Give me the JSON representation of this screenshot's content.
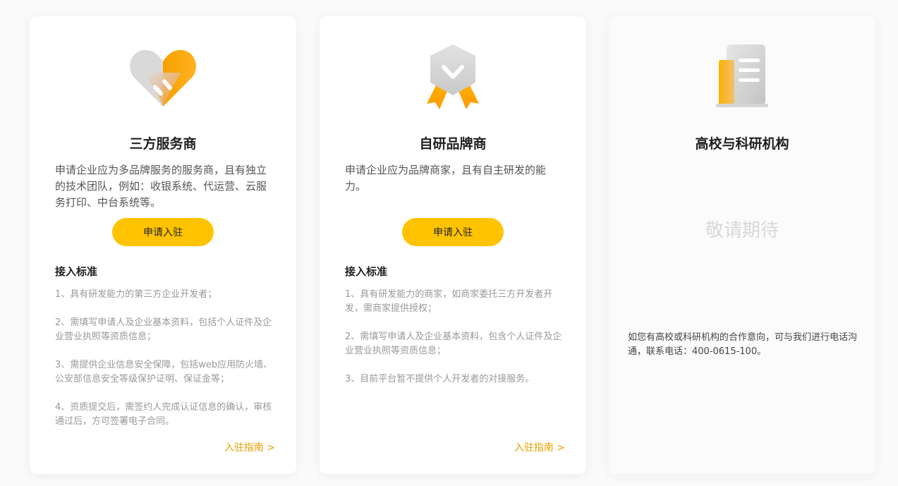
{
  "cards": [
    {
      "title": "三方服务商",
      "description": "申请企业应为多品牌服务的服务商，且有独立的技术团队，例如：收银系统、代运营、云服务打印、中台系统等。",
      "apply_label": "申请入驻",
      "standards_title": "接入标准",
      "standards": [
        "1、具有研发能力的第三方企业开发者；",
        "2、需填写申请人及企业基本资料，包括个人证件及企业营业执照等资质信息；",
        "3、需提供企业信息安全保障，包括web应用防火墙、公安部信息安全等级保护证明、保证金等；",
        "4、资质提交后，需签约人完成认证信息的确认，审核通过后，方可签署电子合同。"
      ],
      "guide_label": "入驻指南 >",
      "icon": "handshake-heart-icon"
    },
    {
      "title": "自研品牌商",
      "description": "申请企业应为品牌商家，且有自主研发的能力。",
      "apply_label": "申请入驻",
      "standards_title": "接入标准",
      "standards": [
        "1、具有研发能力的商家，如商家委托三方开发者开发，需商家提供授权；",
        "2、需填写申请人及企业基本资料，包含个人证件及企业营业执照等资质信息；",
        "3、目前平台暂不提供个人开发者的对接服务。"
      ],
      "guide_label": "入驻指南 >",
      "icon": "award-badge-icon"
    },
    {
      "title": "高校与科研机构",
      "coming_soon": "敬请期待",
      "contact": "如您有高校或科研机构的合作意向，可与我们进行电话沟通，联系电话：400-0615-100。",
      "icon": "building-icon"
    }
  ],
  "colors": {
    "accent": "#ffc300",
    "link": "#e6a200",
    "muted": "#999999"
  }
}
